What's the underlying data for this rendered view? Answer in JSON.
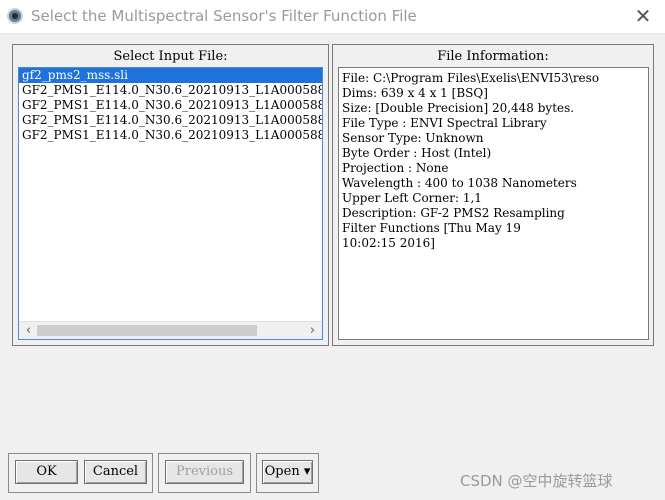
{
  "window": {
    "title": "Select the Multispectral Sensor's Filter Function File",
    "close_glyph": "✕"
  },
  "input_panel": {
    "title": "Select Input File:",
    "files": [
      "gf2_pms2_mss.sli",
      "GF2_PMS1_E114.0_N30.6_20210913_L1A000588",
      "GF2_PMS1_E114.0_N30.6_20210913_L1A000588",
      "GF2_PMS1_E114.0_N30.6_20210913_L1A000588",
      "GF2_PMS1_E114.0_N30.6_20210913_L1A000588"
    ],
    "selected_index": 0,
    "scroll_left": "‹",
    "scroll_right": "›"
  },
  "info_panel": {
    "title": "File Information:",
    "lines": [
      "File: C:\\Program Files\\Exelis\\ENVI53\\reso",
      "Dims: 639 x 4 x 1 [BSQ]",
      "Size: [Double Precision] 20,448 bytes.",
      "File Type  : ENVI Spectral Library",
      "Sensor Type: Unknown",
      "Byte Order : Host (Intel)",
      "Projection : None",
      "Wavelength : 400 to 1038 Nanometers",
      "Upper Left Corner: 1,1",
      "Description: GF-2 PMS2 Resampling",
      "Filter Functions [Thu May 19",
      "10:02:15 2016]"
    ]
  },
  "buttons": {
    "ok": "OK",
    "cancel": "Cancel",
    "previous": "Previous",
    "open": "Open ▾"
  },
  "watermark": "CSDN @空中旋转篮球",
  "colors": {
    "selection": "#1e72d9",
    "list_border": "#4a8ad4"
  }
}
